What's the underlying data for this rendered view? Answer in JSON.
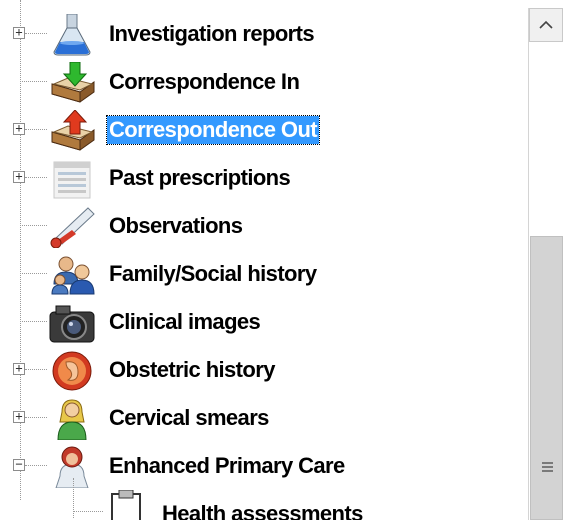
{
  "tree": {
    "items": [
      {
        "label": "Investigation reports",
        "icon": "flask-icon",
        "expander": "+"
      },
      {
        "label": "Correspondence In",
        "icon": "inbox-arrow-in-icon",
        "expander": ""
      },
      {
        "label": "Correspondence Out",
        "icon": "outbox-arrow-out-icon",
        "expander": "+",
        "selected": true
      },
      {
        "label": "Past prescriptions",
        "icon": "prescription-list-icon",
        "expander": "+"
      },
      {
        "label": "Observations",
        "icon": "thermometer-icon",
        "expander": ""
      },
      {
        "label": "Family/Social history",
        "icon": "family-icon",
        "expander": ""
      },
      {
        "label": "Clinical images",
        "icon": "camera-icon",
        "expander": ""
      },
      {
        "label": "Obstetric history",
        "icon": "foetus-icon",
        "expander": "+"
      },
      {
        "label": "Cervical smears",
        "icon": "woman-icon",
        "expander": "+"
      },
      {
        "label": "Enhanced Primary Care",
        "icon": "doctor-icon",
        "expander": "−"
      }
    ],
    "child": {
      "label": "Health assessments",
      "icon": "clipboard-icon"
    }
  },
  "scrollbar": {
    "up_arrow": "^",
    "grip": "≡"
  },
  "colors": {
    "selection": "#3399ff",
    "selection_text": "#ffffff"
  }
}
